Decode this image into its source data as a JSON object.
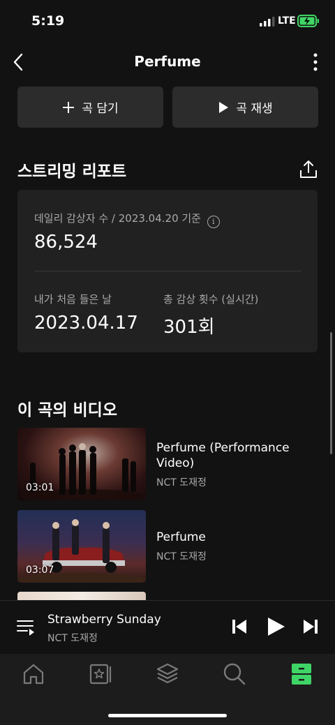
{
  "status": {
    "time": "5:19",
    "network": "LTE"
  },
  "nav": {
    "title": "Perfume"
  },
  "actions": {
    "add_label": "곡 담기",
    "play_label": "곡 재생"
  },
  "report": {
    "title": "스트리밍 리포트",
    "daily_label": "데일리 감상자 수 / 2023.04.20 기준",
    "daily_value": "86,524",
    "first_listen_label": "내가 처음 들은 날",
    "first_listen_value": "2023.04.17",
    "total_plays_label": "총 감상 횟수 (실시간)",
    "total_plays_value": "301회"
  },
  "videos": {
    "title": "이 곡의 비디오",
    "items": [
      {
        "title": "Perfume (Performance Video)",
        "artist": "NCT 도재정",
        "duration": "03:01"
      },
      {
        "title": "Perfume",
        "artist": "NCT 도재정",
        "duration": "03:07"
      }
    ]
  },
  "player": {
    "title": "Strawberry Sunday",
    "artist": "NCT 도재정"
  },
  "colors": {
    "accent": "#3fd566",
    "background": "#121212",
    "card": "#212121"
  },
  "tabs": [
    "home-icon",
    "library-icon",
    "layers-icon",
    "search-icon",
    "storage-icon"
  ]
}
